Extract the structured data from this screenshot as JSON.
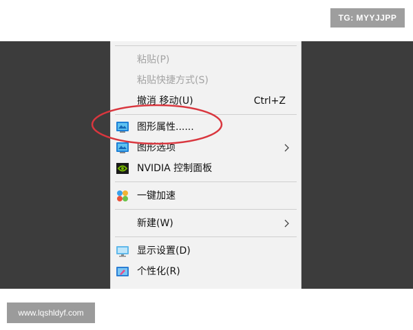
{
  "watermarks": {
    "top_right": "TG: MYYJJPP",
    "bottom_left": "www.lqshldyf.com"
  },
  "context_menu": {
    "items": [
      {
        "label": "粘贴(P)",
        "disabled": true
      },
      {
        "label": "粘贴快捷方式(S)",
        "disabled": true
      },
      {
        "label": "撤消 移动(U)",
        "shortcut": "Ctrl+Z"
      },
      {
        "label": "图形属性......",
        "icon": "graphics-properties-icon"
      },
      {
        "label": "图形选项",
        "icon": "graphics-options-icon",
        "submenu": true
      },
      {
        "label": "NVIDIA 控制面板",
        "icon": "nvidia-icon"
      },
      {
        "label": "一键加速",
        "icon": "speed-up-icon"
      },
      {
        "label": "新建(W)",
        "submenu": true
      },
      {
        "label": "显示设置(D)",
        "icon": "display-settings-icon"
      },
      {
        "label": "个性化(R)",
        "icon": "personalize-icon"
      }
    ],
    "highlight_color": "#d9363e"
  }
}
